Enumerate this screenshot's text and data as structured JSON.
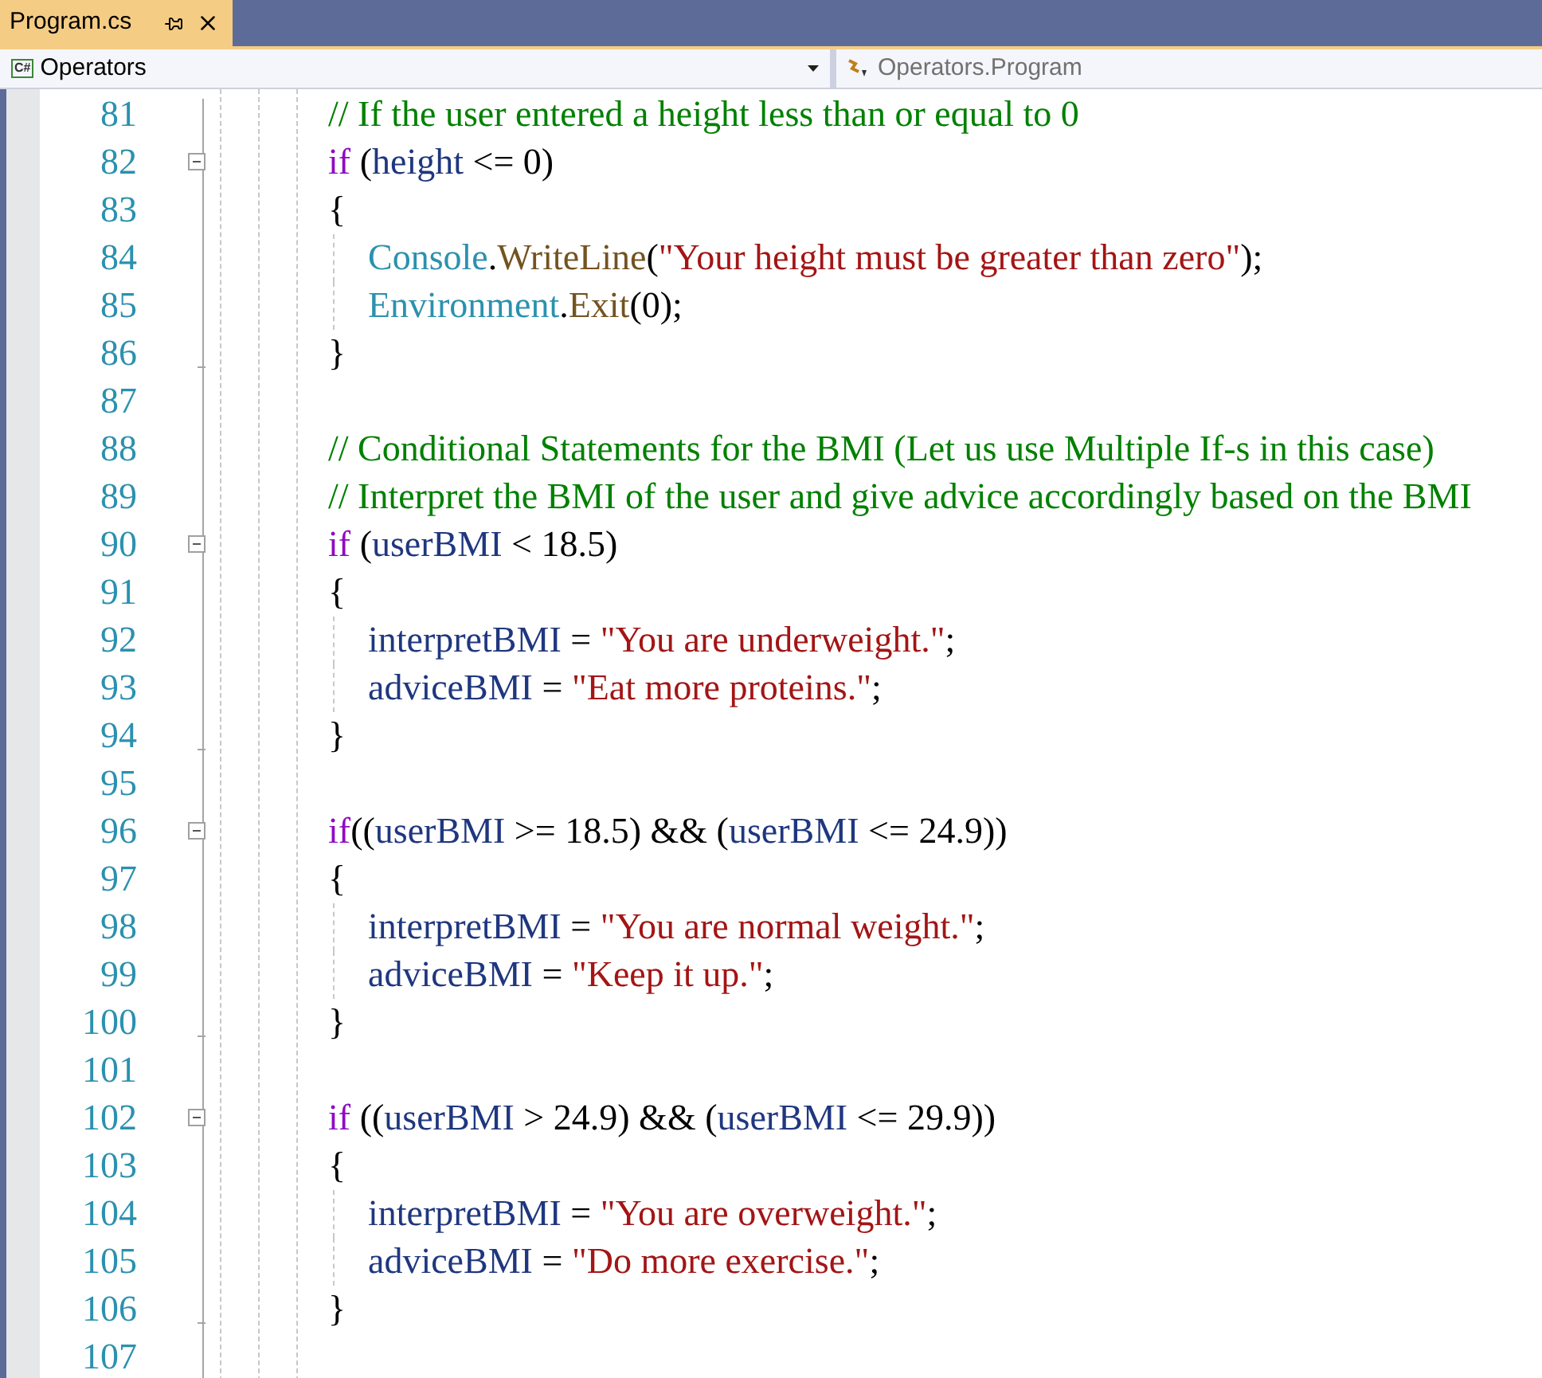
{
  "tab": {
    "title": "Program.cs",
    "selected": true
  },
  "navigation": {
    "language_badge": "C#",
    "project": "Operators",
    "member": "Operators.Program"
  },
  "lines": [
    {
      "number": "81",
      "indented": false,
      "tokens": [
        {
          "kind": "c",
          "text": "// If the user entered a height less than or equal to 0"
        }
      ]
    },
    {
      "number": "82",
      "indented": false,
      "fold_expanded": true,
      "tokens": [
        {
          "kind": "k",
          "text": "if"
        },
        {
          "kind": "p",
          "text": " ("
        },
        {
          "kind": "v",
          "text": "height"
        },
        {
          "kind": "p",
          "text": " <= 0)"
        }
      ]
    },
    {
      "number": "83",
      "indented": false,
      "tokens": [
        {
          "kind": "p",
          "text": "{"
        }
      ]
    },
    {
      "number": "84",
      "indented": true,
      "tokens": [
        {
          "kind": "t",
          "text": "Console"
        },
        {
          "kind": "p",
          "text": "."
        },
        {
          "kind": "m",
          "text": "WriteLine"
        },
        {
          "kind": "p",
          "text": "("
        },
        {
          "kind": "s",
          "text": "\"Your height must be greater than zero\""
        },
        {
          "kind": "p",
          "text": ");"
        }
      ]
    },
    {
      "number": "85",
      "indented": true,
      "tokens": [
        {
          "kind": "t",
          "text": "Environment"
        },
        {
          "kind": "p",
          "text": "."
        },
        {
          "kind": "m",
          "text": "Exit"
        },
        {
          "kind": "p",
          "text": "(0);"
        }
      ]
    },
    {
      "number": "86",
      "indented": false,
      "block_end": true,
      "tokens": [
        {
          "kind": "p",
          "text": "}"
        }
      ]
    },
    {
      "number": "87",
      "indented": false
    },
    {
      "number": "88",
      "indented": false,
      "tokens": [
        {
          "kind": "c",
          "text": "// Conditional Statements for the BMI (Let us use Multiple If-s in this case)"
        }
      ]
    },
    {
      "number": "89",
      "indented": false,
      "tokens": [
        {
          "kind": "c",
          "text": "// Interpret the BMI of the user and give advice accordingly based on the BMI"
        }
      ]
    },
    {
      "number": "90",
      "indented": false,
      "fold_expanded": true,
      "tokens": [
        {
          "kind": "k",
          "text": "if"
        },
        {
          "kind": "p",
          "text": " ("
        },
        {
          "kind": "v",
          "text": "userBMI"
        },
        {
          "kind": "p",
          "text": " < 18.5)"
        }
      ]
    },
    {
      "number": "91",
      "indented": false,
      "tokens": [
        {
          "kind": "p",
          "text": "{"
        }
      ]
    },
    {
      "number": "92",
      "indented": true,
      "tokens": [
        {
          "kind": "v",
          "text": "interpretBMI"
        },
        {
          "kind": "p",
          "text": " = "
        },
        {
          "kind": "s",
          "text": "\"You are underweight.\""
        },
        {
          "kind": "p",
          "text": ";"
        }
      ]
    },
    {
      "number": "93",
      "indented": true,
      "tokens": [
        {
          "kind": "v",
          "text": "adviceBMI"
        },
        {
          "kind": "p",
          "text": " = "
        },
        {
          "kind": "s",
          "text": "\"Eat more proteins.\""
        },
        {
          "kind": "p",
          "text": ";"
        }
      ]
    },
    {
      "number": "94",
      "indented": false,
      "block_end": true,
      "tokens": [
        {
          "kind": "p",
          "text": "}"
        }
      ]
    },
    {
      "number": "95",
      "indented": false
    },
    {
      "number": "96",
      "indented": false,
      "fold_expanded": true,
      "tokens": [
        {
          "kind": "k",
          "text": "if"
        },
        {
          "kind": "p",
          "text": "(("
        },
        {
          "kind": "v",
          "text": "userBMI"
        },
        {
          "kind": "p",
          "text": " >= 18.5) && ("
        },
        {
          "kind": "v",
          "text": "userBMI"
        },
        {
          "kind": "p",
          "text": " <= 24.9))"
        }
      ]
    },
    {
      "number": "97",
      "indented": false,
      "tokens": [
        {
          "kind": "p",
          "text": "{"
        }
      ]
    },
    {
      "number": "98",
      "indented": true,
      "tokens": [
        {
          "kind": "v",
          "text": "interpretBMI"
        },
        {
          "kind": "p",
          "text": " = "
        },
        {
          "kind": "s",
          "text": "\"You are normal weight.\""
        },
        {
          "kind": "p",
          "text": ";"
        }
      ]
    },
    {
      "number": "99",
      "indented": true,
      "tokens": [
        {
          "kind": "v",
          "text": "adviceBMI"
        },
        {
          "kind": "p",
          "text": " = "
        },
        {
          "kind": "s",
          "text": "\"Keep it up.\""
        },
        {
          "kind": "p",
          "text": ";"
        }
      ]
    },
    {
      "number": "100",
      "indented": false,
      "block_end": true,
      "tokens": [
        {
          "kind": "p",
          "text": "}"
        }
      ]
    },
    {
      "number": "101",
      "indented": false
    },
    {
      "number": "102",
      "indented": false,
      "fold_expanded": true,
      "tokens": [
        {
          "kind": "k",
          "text": "if"
        },
        {
          "kind": "p",
          "text": " (("
        },
        {
          "kind": "v",
          "text": "userBMI"
        },
        {
          "kind": "p",
          "text": " > 24.9) && ("
        },
        {
          "kind": "v",
          "text": "userBMI"
        },
        {
          "kind": "p",
          "text": " <= 29.9))"
        }
      ]
    },
    {
      "number": "103",
      "indented": false,
      "tokens": [
        {
          "kind": "p",
          "text": "{"
        }
      ]
    },
    {
      "number": "104",
      "indented": true,
      "tokens": [
        {
          "kind": "v",
          "text": "interpretBMI"
        },
        {
          "kind": "p",
          "text": " = "
        },
        {
          "kind": "s",
          "text": "\"You are overweight.\""
        },
        {
          "kind": "p",
          "text": ";"
        }
      ]
    },
    {
      "number": "105",
      "indented": true,
      "tokens": [
        {
          "kind": "v",
          "text": "adviceBMI"
        },
        {
          "kind": "p",
          "text": " = "
        },
        {
          "kind": "s",
          "text": "\"Do more exercise.\""
        },
        {
          "kind": "p",
          "text": ";"
        }
      ]
    },
    {
      "number": "106",
      "indented": false,
      "block_end": true,
      "tokens": [
        {
          "kind": "p",
          "text": "}"
        }
      ]
    },
    {
      "number": "107",
      "indented": false
    }
  ]
}
